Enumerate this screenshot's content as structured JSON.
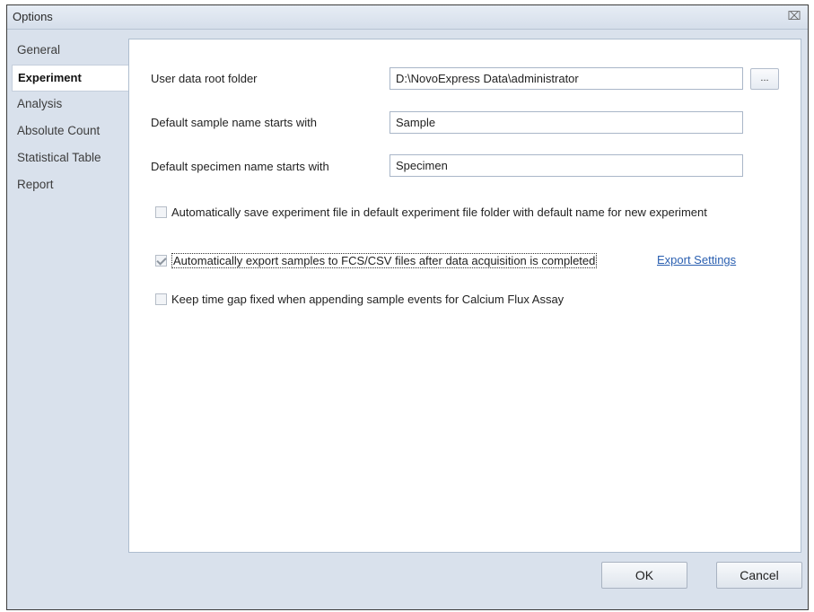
{
  "window": {
    "title": "Options",
    "close_glyph": "⌧"
  },
  "sidebar": {
    "items": [
      {
        "label": "General",
        "active": false
      },
      {
        "label": "Experiment",
        "active": true
      },
      {
        "label": "Analysis",
        "active": false
      },
      {
        "label": "Absolute Count",
        "active": false
      },
      {
        "label": "Statistical Table",
        "active": false
      },
      {
        "label": "Report",
        "active": false
      }
    ]
  },
  "experiment": {
    "user_data_root": {
      "label": "User data root folder",
      "value": "D:\\NovoExpress Data\\administrator",
      "browse_label": "..."
    },
    "sample_name": {
      "label": "Default sample name starts with",
      "value": "Sample"
    },
    "specimen_name": {
      "label": "Default specimen name starts with",
      "value": "Specimen"
    },
    "auto_save": {
      "label": "Automatically save experiment file in default experiment file folder with default name for new experiment",
      "checked": false
    },
    "auto_export": {
      "label": "Automatically export samples to FCS/CSV files after data acquisition is completed",
      "checked": true,
      "link_label": "Export Settings"
    },
    "keep_time_gap": {
      "label": "Keep time gap fixed when appending sample events for Calcium Flux Assay",
      "checked": false
    }
  },
  "footer": {
    "ok_label": "OK",
    "cancel_label": "Cancel"
  }
}
